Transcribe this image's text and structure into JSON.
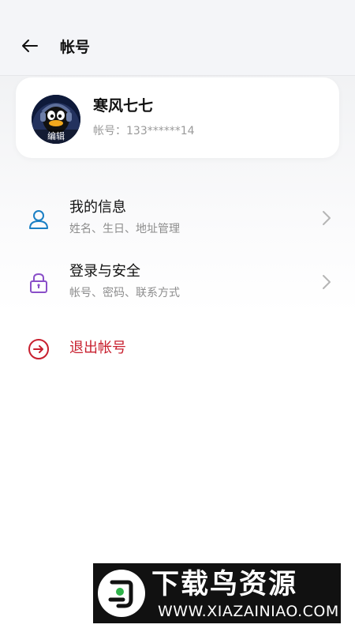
{
  "header": {
    "back_icon": "arrow-left-icon",
    "title": "帐号"
  },
  "profile": {
    "avatar_edit_label": "编辑",
    "nickname": "寒风七七",
    "account_text": "帐号：133******14"
  },
  "menu": {
    "items": [
      {
        "icon": "person-icon",
        "title": "我的信息",
        "subtitle": "姓名、生日、地址管理",
        "icon_color": "#1a7fc4"
      },
      {
        "icon": "lock-icon",
        "title": "登录与安全",
        "subtitle": "帐号、密码、联系方式",
        "icon_color": "#8a4fc8"
      }
    ],
    "logout": {
      "icon": "logout-arrow-icon",
      "label": "退出帐号",
      "color": "#c8202f"
    }
  },
  "watermark": {
    "title": "下载鸟资源",
    "url": "WWW.XIAZAINIAO.COM"
  }
}
